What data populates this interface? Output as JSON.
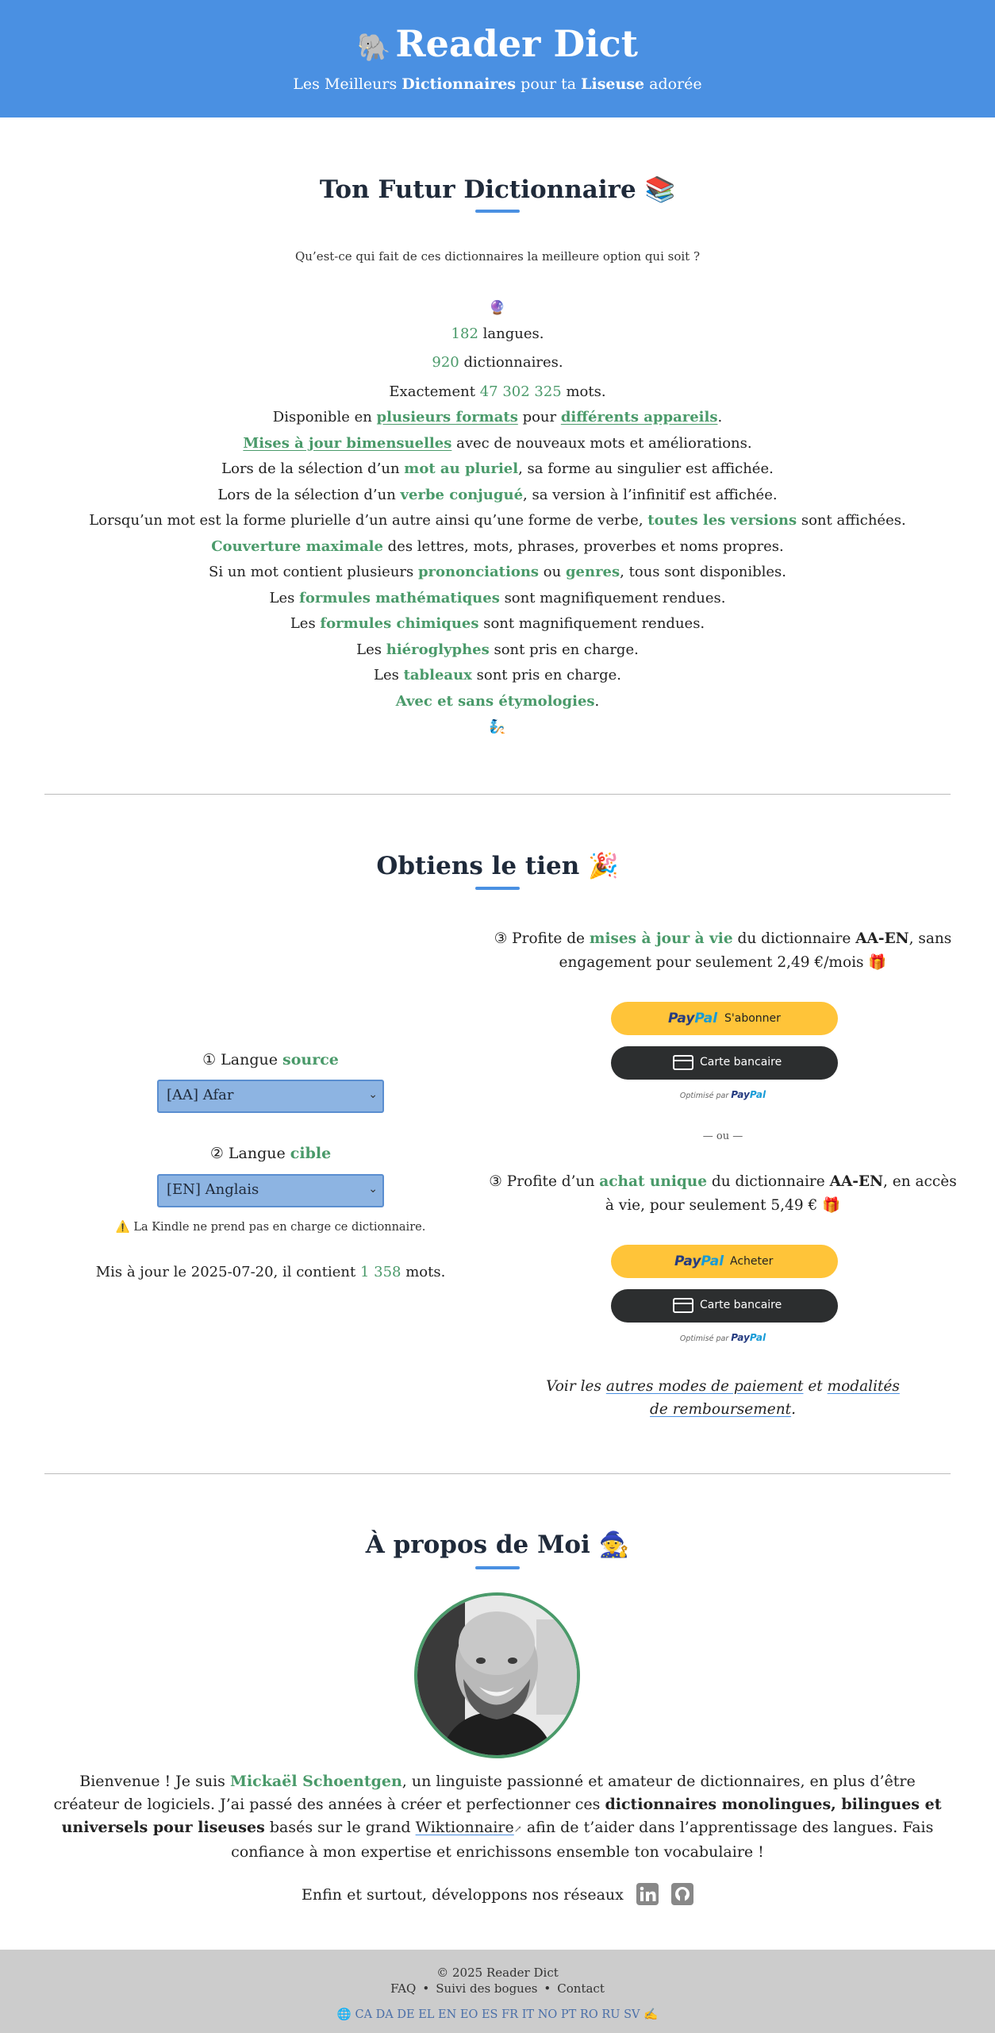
{
  "header": {
    "logo_emoji": "🐘",
    "title": "Reader Dict",
    "tagline": {
      "p1": "Les Meilleurs ",
      "b1": "Dictionnaires",
      "p2": " pour ta ",
      "b2": "Liseuse",
      "p3": " adorée"
    }
  },
  "features_section": {
    "title": "Ton Futur Dictionnaire 📚",
    "question": "Qu’est-ce qui fait de ces dictionnaires la meilleure option qui soit ?",
    "top_emoji": "🔮",
    "bottom_emoji": "🧞",
    "langs_count": "182",
    "langs_text": " langues.",
    "dicts_count": "920",
    "dicts_text": " dictionnaires.",
    "words_prefix": "Exactement ",
    "words_count": "47 302 325",
    "words_text": " mots.",
    "formats": {
      "p1": "Disponible en ",
      "l1": "plusieurs formats",
      "p2": " pour ",
      "l2": "différents appareils",
      "p3": "."
    },
    "updates": {
      "l1": "Mises à jour bimensuelles",
      "p1": " avec de nouveaux mots et améliorations."
    },
    "plural": {
      "p1": "Lors de la sélection d’un ",
      "g1": "mot au pluriel",
      "p2": ", sa forme au singulier est affichée."
    },
    "verb": {
      "p1": "Lors de la sélection d’un ",
      "g1": "verbe conjugué",
      "p2": ", sa version à l’infinitif est affichée."
    },
    "versions": {
      "p1": "Lorsqu’un mot est la forme plurielle d’un autre ainsi qu’une forme de verbe, ",
      "g1": "toutes les versions",
      "p2": " sont affichées."
    },
    "coverage": {
      "g1": "Couverture maximale",
      "p1": " des lettres, mots, phrases, proverbes et noms propres."
    },
    "pron": {
      "p1": "Si un mot contient plusieurs ",
      "g1": "prononciations",
      "p2": " ou ",
      "g2": "genres",
      "p3": ", tous sont disponibles."
    },
    "math": {
      "p1": "Les ",
      "g1": "formules mathématiques",
      "p2": " sont magnifiquement rendues."
    },
    "chem": {
      "p1": "Les ",
      "g1": "formules chimiques",
      "p2": " sont magnifiquement rendues."
    },
    "hiero": {
      "p1": "Les ",
      "g1": "hiéroglyphes",
      "p2": " sont pris en charge."
    },
    "tables": {
      "p1": "Les ",
      "g1": "tableaux",
      "p2": " sont pris en charge."
    },
    "etym": {
      "g1": "Avec et sans étymologies",
      "p1": "."
    }
  },
  "get_section": {
    "title": "Obtiens le tien 🎉",
    "source_label": {
      "n": "①",
      "p1": " Langue ",
      "g1": "source"
    },
    "source_value": "[AA] Afar",
    "target_label": {
      "n": "②",
      "p1": " Langue ",
      "g1": "cible"
    },
    "target_value": "[EN] Anglais",
    "warning": "⚠️ La Kindle ne prend pas en charge ce dictionnaire.",
    "updated": {
      "p1": "Mis à jour le 2025-07-20, il contient ",
      "n1": "1 358",
      "p2": " mots."
    },
    "sub_offer": {
      "n": "③",
      "p1": " Profite de ",
      "g1": "mises à jour à vie",
      "p2": " du dictionnaire ",
      "b1": "AA-EN",
      "p3": ", sans engagement pour seulement 2,49 €/mois 🎁"
    },
    "sub_paypal_action": "S'abonner",
    "buy_offer": {
      "n": "③",
      "p1": " Profite d’un ",
      "g1": "achat unique",
      "p2": " du dictionnaire ",
      "b1": "AA-EN",
      "p3": ", en accès à vie, pour seulement 5,49 € 🎁"
    },
    "buy_paypal_action": "Acheter",
    "paypal_p1": "Pay",
    "paypal_p2": "Pal",
    "card_label": "Carte bancaire",
    "powered_text": "Optimisé par ",
    "or_text": "— ou —",
    "other_pay": {
      "p1": "Voir les ",
      "l1": "autres modes de paiement",
      "p2": " et ",
      "l2": "modalités de remboursement",
      "p3": "."
    }
  },
  "about_section": {
    "title": "À propos de Moi 🧙",
    "p1": "Bienvenue ! Je suis ",
    "name": "Mickaël Schoentgen",
    "p2": ", un linguiste passionné et amateur de dictionnaires, en plus d’être créateur de logiciels. J’ai passé des années à créer et perfectionner ces ",
    "b1": "dictionnaires monolingues, bilingues et universels pour liseuses",
    "p3": " basés sur le grand ",
    "wiki": "Wiktionnaire",
    "p4": " afin de t’aider dans l’apprentissage des langues. Fais confiance à mon expertise et enrichissons ensemble ton vocabulaire !",
    "social_text": "Enfin et surtout, développons nos réseaux",
    "social_icons": [
      "linkedin-icon",
      "github-icon"
    ]
  },
  "footer": {
    "copyright": "© 2025 Reader Dict",
    "links": [
      "FAQ",
      "Suivi des bogues",
      "Contact"
    ],
    "langs": "🌐 CA DA DE EL EN EO ES FR IT NO PT RO RU SV ✍️"
  },
  "colors": {
    "header_bg": "#4a90e2",
    "accent_green": "#4a9a6a",
    "footer_bg": "#cccccc",
    "paypal_yellow": "#ffc439"
  }
}
